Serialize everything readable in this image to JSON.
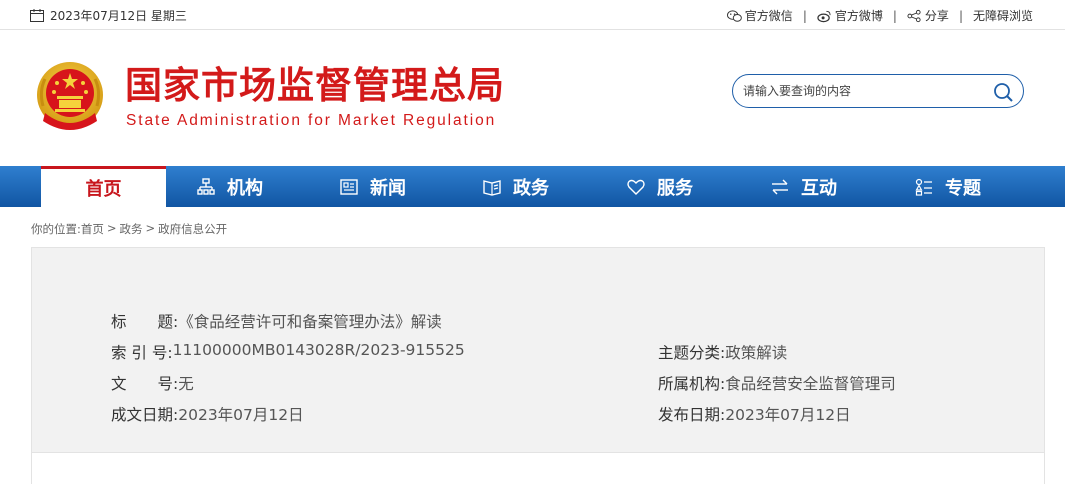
{
  "topbar": {
    "date": "2023年07月12日 星期三",
    "links": [
      {
        "label": "官方微信",
        "icon": "wechat-icon"
      },
      {
        "label": "官方微博",
        "icon": "weibo-icon"
      },
      {
        "label": "分享",
        "icon": "share-icon"
      },
      {
        "label": "无障碍浏览",
        "icon": ""
      }
    ],
    "separator": "|"
  },
  "header": {
    "title": "国家市场监督管理总局",
    "subtitle": "State Administration for Market Regulation",
    "search_placeholder": "请输入要查询的内容"
  },
  "nav": {
    "items": [
      {
        "label": "首页",
        "icon": "",
        "active": true
      },
      {
        "label": "机构",
        "icon": "org-icon"
      },
      {
        "label": "新闻",
        "icon": "news-icon"
      },
      {
        "label": "政务",
        "icon": "gov-icon"
      },
      {
        "label": "服务",
        "icon": "heart-icon"
      },
      {
        "label": "互动",
        "icon": "exchange-icon"
      },
      {
        "label": "专题",
        "icon": "topic-icon"
      }
    ],
    "accent_color": "#c8161d",
    "bar_color": "#1f6bbd"
  },
  "breadcrumb": {
    "prefix": "你的位置:",
    "items": [
      "首页",
      "政务",
      "政府信息公开"
    ],
    "separator": ">"
  },
  "info": {
    "title_label": "标　　题:",
    "title_value": "《食品经营许可和备案管理办法》解读",
    "index_label": "索 引 号:",
    "index_value": "11100000MB0143028R/2023-915525",
    "doc_no_label": "文　　号:",
    "doc_no_value": "无",
    "created_label": "成文日期:",
    "created_value": "2023年07月12日",
    "topic_label": "主题分类:",
    "topic_value": "政策解读",
    "org_label": "所属机构:",
    "org_value": "食品经营安全监督管理司",
    "published_label": "发布日期:",
    "published_value": "2023年07月12日"
  }
}
